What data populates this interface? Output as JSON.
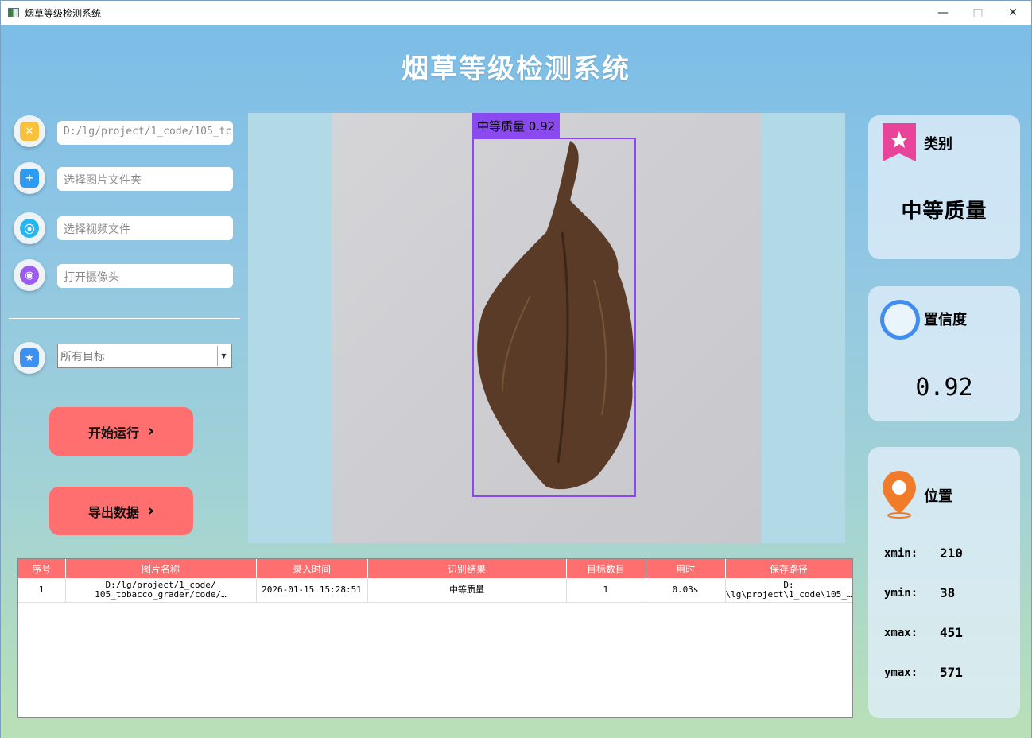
{
  "window": {
    "title": "烟草等级检测系统",
    "minimize": "—",
    "maximize": "□",
    "close": "✕"
  },
  "app_title": "烟草等级检测系统",
  "inputs": {
    "image_path": "D:/lg/project/1_code/105_tc",
    "folder_placeholder": "选择图片文件夹",
    "video_placeholder": "选择视频文件",
    "camera_placeholder": "打开摄像头"
  },
  "target_select": {
    "selected": "所有目标"
  },
  "buttons": {
    "run": "开始运行",
    "export": "导出数据",
    "chevron": "›"
  },
  "detection": {
    "label": "中等质量 0.92"
  },
  "cards": {
    "category": {
      "title": "类别",
      "value": "中等质量"
    },
    "confidence": {
      "title": "置信度",
      "value": "0.92"
    },
    "position": {
      "title": "位置",
      "xmin_label": "xmin:",
      "xmin": "210",
      "ymin_label": "ymin:",
      "ymin": "38",
      "xmax_label": "xmax:",
      "xmax": "451",
      "ymax_label": "ymax:",
      "ymax": "571"
    }
  },
  "table": {
    "headers": [
      "序号",
      "图片名称",
      "录入时间",
      "识别结果",
      "目标数目",
      "用时",
      "保存路径"
    ],
    "rows": [
      {
        "index": "1",
        "name_line1": "D:/lg/project/1_code/",
        "name_line2": "105_tobacco_grader/code/…",
        "time": "2026-01-15 15:28:51",
        "result": "中等质量",
        "count": "1",
        "duration": "0.03s",
        "path_line1": "D:",
        "path_line2": "\\lg\\project\\1_code\\105_…"
      }
    ]
  },
  "colors": {
    "accent": "#ff6f6f",
    "box": "#8a4af0",
    "viewer_bg": "#b2dae6"
  }
}
